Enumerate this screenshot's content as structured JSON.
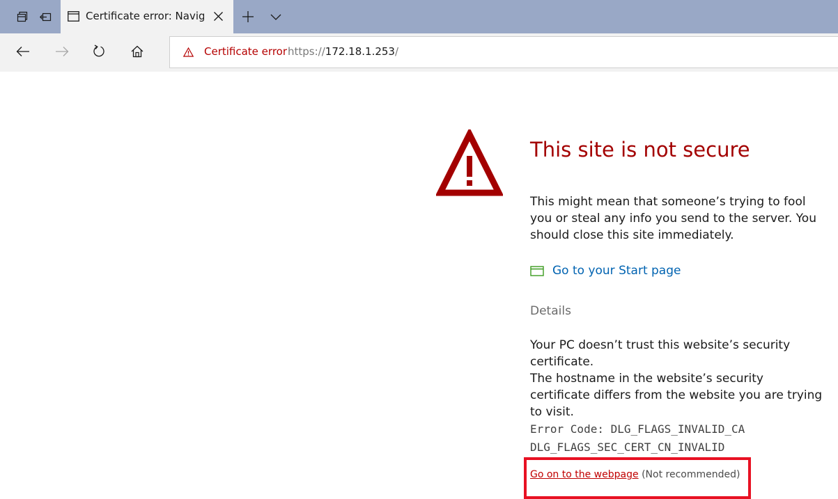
{
  "tab": {
    "title": "Certificate error: Naviga"
  },
  "address_bar": {
    "warning_label": "Certificate error",
    "url_scheme": "https://",
    "url_host": "172.18.1.253",
    "url_path": "/"
  },
  "page": {
    "heading": "This site is not secure",
    "intro": "This might mean that someone’s trying to fool you or steal any info you send to the server. You should close this site immediately.",
    "start_link": "Go to your Start page",
    "details_label": "Details",
    "detail_line1": "Your PC doesn’t trust this website’s security certificate.",
    "detail_line2": "The hostname in the website’s security certificate differs from the website you are trying to visit.",
    "error_code_line1": "Error Code: DLG_FLAGS_INVALID_CA",
    "error_code_line2": "DLG_FLAGS_SEC_CERT_CN_INVALID",
    "go_on_link": "Go on to the webpage",
    "go_on_note": "(Not recommended)"
  },
  "colors": {
    "tabstrip": "#99a8c6",
    "error_red": "#a30000",
    "link_blue": "#0063b1",
    "highlight_box": "#e81123"
  },
  "icons": {
    "set_aside_tabs": "set-aside-tabs-icon",
    "show_set_aside": "show-set-aside-tabs-icon",
    "tab_favicon": "page-icon",
    "tab_close": "close-icon",
    "new_tab": "plus-icon",
    "tab_preview": "chevron-down-icon",
    "back": "arrow-left-icon",
    "forward": "arrow-right-icon",
    "refresh": "refresh-icon",
    "home": "home-icon",
    "address_warning": "warning-triangle-icon",
    "big_warning": "warning-triangle-icon",
    "start_page": "start-page-icon"
  }
}
